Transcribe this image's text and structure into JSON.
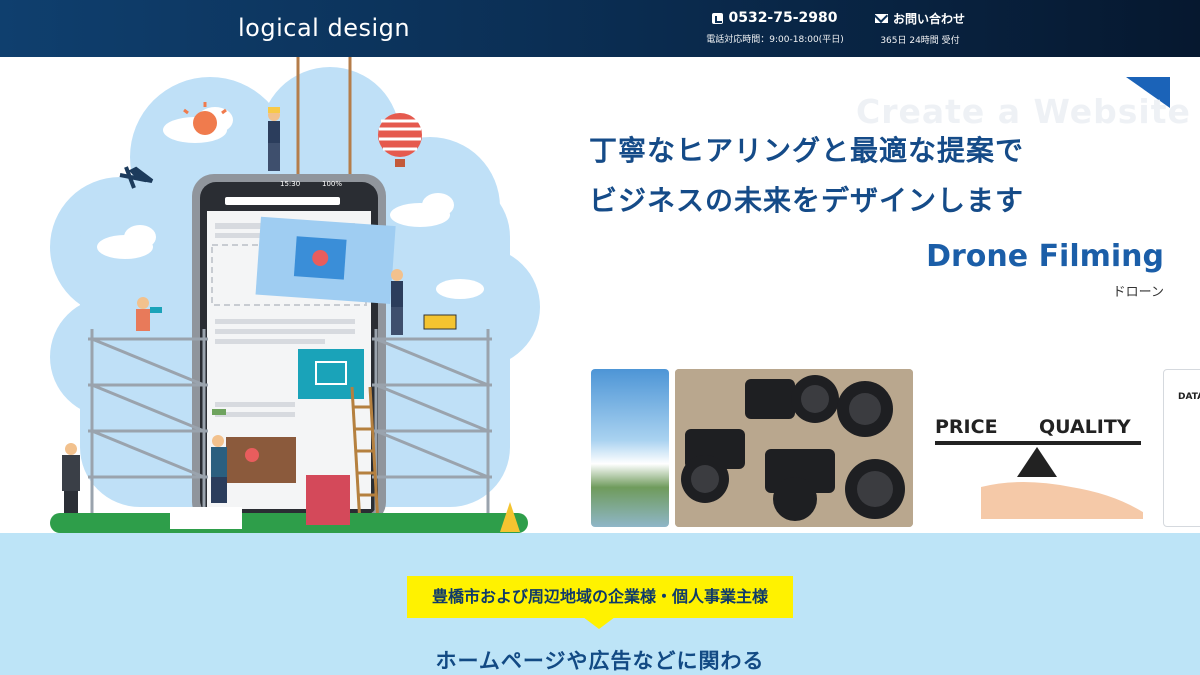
{
  "header": {
    "logo": "logical design",
    "phone": {
      "number": "0532-75-2980",
      "hours": "電話対応時間：9:00-18:00(平日)",
      "icon": "phone-icon"
    },
    "inquiry": {
      "label": "お問い合わせ",
      "hours": "365日 24時間 受付",
      "icon": "mail-icon"
    }
  },
  "hero": {
    "ghost_text": "Create a Website",
    "headline_line1": "丁寧なヒアリングと最適な提案で",
    "headline_line2": "ビジネスの未来をデザインします",
    "service_en": "Drone Filming",
    "service_jp": "ドローン",
    "thumbnails": {
      "price_label": "PRICE",
      "quality_label": "QUALITY",
      "data_label": "DATA"
    },
    "illustration": {
      "phone_time": "15:30",
      "phone_battery": "100%"
    }
  },
  "lower": {
    "badge": "豊橋市および周辺地域の企業様・個人事業主様",
    "heading": "ホームページや広告などに関わる"
  },
  "colors": {
    "header_dark": "#06182f",
    "brand_blue": "#154b88",
    "accent_blue": "#1b63b8",
    "badge_yellow": "#fff200",
    "lower_bg": "#bde4f7"
  }
}
